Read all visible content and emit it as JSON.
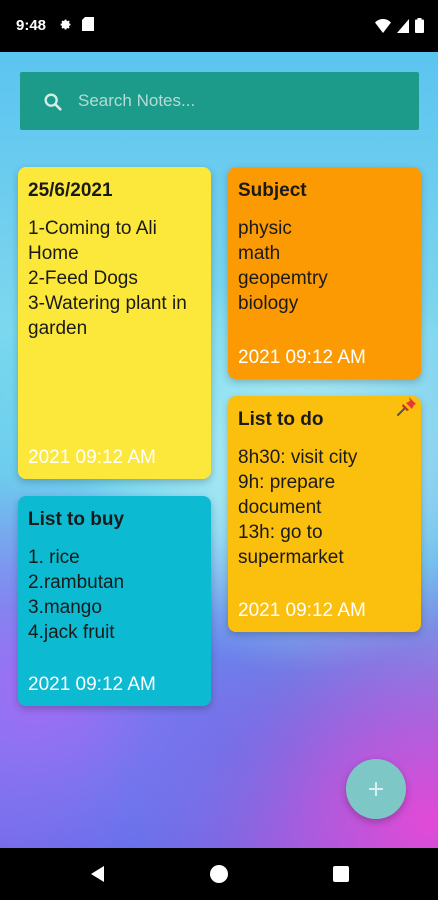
{
  "status_bar": {
    "time": "9:48",
    "left_icons": [
      "gear-icon",
      "sd-card-icon"
    ],
    "right_icons": [
      "wifi-icon",
      "signal-icon",
      "battery-icon"
    ]
  },
  "search": {
    "placeholder": "Search Notes...",
    "value": ""
  },
  "notes": [
    {
      "title": "25/6/2021",
      "body": "1-Coming to Ali Home\n2-Feed Dogs\n3-Watering plant in garden",
      "date": "2021 09:12 AM",
      "color": "#fce83a",
      "pinned": false
    },
    {
      "title": "Subject",
      "body": "physic\nmath\ngeopemtry\nbiology",
      "date": "2021 09:12 AM",
      "color": "#fb9a03",
      "pinned": false
    },
    {
      "title": "List to do",
      "body": "8h30: visit city\n9h: prepare document\n13h: go to supermarket",
      "date": "2021 09:12 AM",
      "color": "#fbbf0d",
      "pinned": true
    },
    {
      "title": "List to buy",
      "body": "1. rice\n2.rambutan\n3.mango\n4.jack fruit",
      "date": "2021 09:12 AM",
      "color": "#0cbad1",
      "pinned": false
    }
  ],
  "fab": {
    "icon": "plus-icon",
    "color": "#7dc8c6"
  },
  "nav_bar": {
    "icons": [
      "back-icon",
      "home-icon",
      "recents-icon"
    ]
  }
}
